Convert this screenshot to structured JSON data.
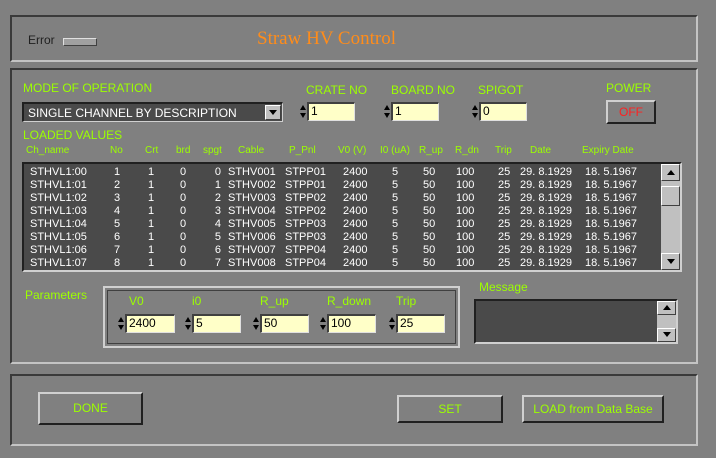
{
  "window": {
    "title": "Straw  HV Control",
    "error_label": "Error"
  },
  "colors": {
    "background": "#808080",
    "title": "#ff8c1a",
    "label": "#9cff00",
    "field": "#ffffc8",
    "power_off": "#ff2020",
    "table_bg": "#4a4a4a"
  },
  "mode": {
    "label": "MODE OF OPERATION",
    "value": "SINGLE CHANNEL BY DESCRIPTION"
  },
  "crate": {
    "label": "CRATE NO",
    "value": "1"
  },
  "board": {
    "label": "BOARD NO",
    "value": "1"
  },
  "spigot": {
    "label": "SPIGOT",
    "value": "0"
  },
  "power": {
    "label": "POWER",
    "button": "OFF"
  },
  "loaded": {
    "label": "LOADED VALUES",
    "columns": [
      "Ch_name",
      "No",
      "Crt",
      "brd",
      "spgt",
      "Cable",
      "P_Pnl",
      "V0 (V)",
      "I0 (uA)",
      "R_up",
      "R_dn",
      "Trip",
      "Date",
      "Expiry Date"
    ],
    "rows": [
      [
        "STHVL1:00",
        "1",
        "1",
        "0",
        "0",
        "STHV001",
        "STPP01",
        "2400",
        "5",
        "50",
        "100",
        "25",
        "29. 8.1929",
        "18. 5.1967"
      ],
      [
        "STHVL1:01",
        "2",
        "1",
        "0",
        "1",
        "STHV002",
        "STPP01",
        "2400",
        "5",
        "50",
        "100",
        "25",
        "29. 8.1929",
        "18. 5.1967"
      ],
      [
        "STHVL1:02",
        "3",
        "1",
        "0",
        "2",
        "STHV003",
        "STPP02",
        "2400",
        "5",
        "50",
        "100",
        "25",
        "29. 8.1929",
        "18. 5.1967"
      ],
      [
        "STHVL1:03",
        "4",
        "1",
        "0",
        "3",
        "STHV004",
        "STPP02",
        "2400",
        "5",
        "50",
        "100",
        "25",
        "29. 8.1929",
        "18. 5.1967"
      ],
      [
        "STHVL1:04",
        "5",
        "1",
        "0",
        "4",
        "STHV005",
        "STPP03",
        "2400",
        "5",
        "50",
        "100",
        "25",
        "29. 8.1929",
        "18. 5.1967"
      ],
      [
        "STHVL1:05",
        "6",
        "1",
        "0",
        "5",
        "STHV006",
        "STPP03",
        "2400",
        "5",
        "50",
        "100",
        "25",
        "29. 8.1929",
        "18. 5.1967"
      ],
      [
        "STHVL1:06",
        "7",
        "1",
        "0",
        "6",
        "STHV007",
        "STPP04",
        "2400",
        "5",
        "50",
        "100",
        "25",
        "29. 8.1929",
        "18. 5.1967"
      ],
      [
        "STHVL1:07",
        "8",
        "1",
        "0",
        "7",
        "STHV008",
        "STPP04",
        "2400",
        "5",
        "50",
        "100",
        "25",
        "29. 8.1929",
        "18. 5.1967"
      ]
    ]
  },
  "parameters": {
    "label": "Parameters",
    "fields": [
      {
        "label": "V0",
        "value": "2400"
      },
      {
        "label": "i0",
        "value": "5"
      },
      {
        "label": "R_up",
        "value": "50"
      },
      {
        "label": "R_down",
        "value": "100"
      },
      {
        "label": "Trip",
        "value": "25"
      }
    ]
  },
  "message": {
    "label": "Message",
    "value": ""
  },
  "buttons": {
    "done": "DONE",
    "set": "SET",
    "load": "LOAD from Data Base"
  }
}
